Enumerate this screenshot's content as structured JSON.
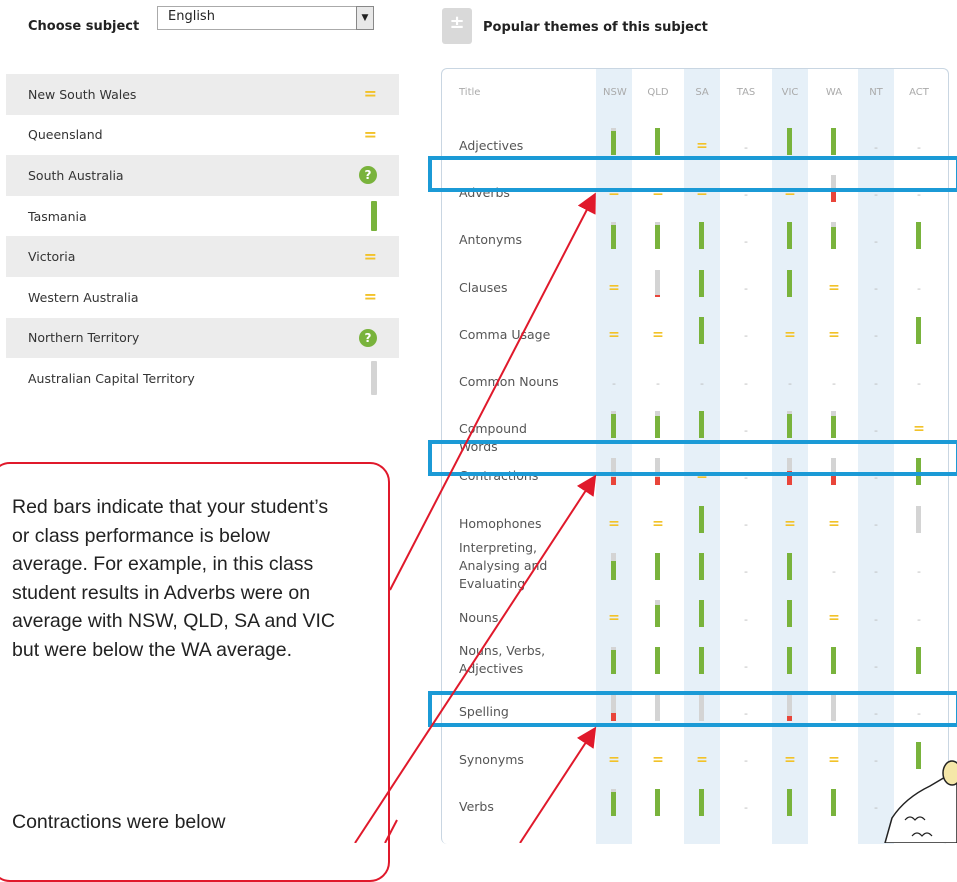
{
  "left_panel": {
    "choose_label": "Choose subject",
    "subject_value": "English",
    "states": [
      {
        "name": "New South Wales",
        "indicator": "equal",
        "shaded": true
      },
      {
        "name": "Queensland",
        "indicator": "equal",
        "shaded": false
      },
      {
        "name": "South Australia",
        "indicator": "question",
        "shaded": true
      },
      {
        "name": "Tasmania",
        "indicator": "green-bar",
        "shaded": false
      },
      {
        "name": "Victoria",
        "indicator": "equal",
        "shaded": true
      },
      {
        "name": "Western Australia",
        "indicator": "equal",
        "shaded": false
      },
      {
        "name": "Northern Territory",
        "indicator": "question",
        "shaded": true
      },
      {
        "name": "Australian Capital Territory",
        "indicator": "grey-bar",
        "shaded": false
      }
    ],
    "equal_symbol": "=",
    "question_symbol": "?"
  },
  "themes": {
    "header_title": "Popular themes of this subject",
    "icon_glyph": "±",
    "columns": [
      "Title",
      "NSW",
      "QLD",
      "SA",
      "TAS",
      "VIC",
      "WA",
      "NT",
      "ACT"
    ],
    "rows": [
      {
        "title": "Adjectives",
        "cells": [
          "g0.9",
          "g1.0",
          "eq",
          "-",
          "g1.0",
          "g1.0",
          "-",
          "-"
        ]
      },
      {
        "title": "Adverbs",
        "cells": [
          "eq",
          "eq",
          "eq",
          "-",
          "eq",
          "r0.4",
          "-",
          "-"
        ]
      },
      {
        "title": "Antonyms",
        "cells": [
          "g0.9",
          "g0.9",
          "g1.0",
          "-",
          "g1.0",
          "g0.8",
          "-",
          "g1.0"
        ]
      },
      {
        "title": "Clauses",
        "cells": [
          "eq",
          "r0.05",
          "g1.0",
          "-",
          "g1.0",
          "eq",
          "-",
          "-"
        ]
      },
      {
        "title": "Comma Usage",
        "cells": [
          "eq",
          "eq",
          "g1.0",
          "-",
          "eq",
          "eq",
          "-",
          "g1.0"
        ]
      },
      {
        "title": "Common Nouns",
        "cells": [
          "-",
          "-",
          "-",
          "-",
          "-",
          "-",
          "-",
          "-"
        ]
      },
      {
        "title": "Compound Words",
        "cells": [
          "g0.9",
          "g0.8",
          "g1.0",
          "-",
          "g0.9",
          "g0.8",
          "-",
          "eq"
        ]
      },
      {
        "title": "Contractions",
        "cells": [
          "r0.3",
          "r0.3",
          "eq",
          "-",
          "r0.5",
          "r0.4",
          "-",
          "g1.0"
        ]
      },
      {
        "title": "Homophones",
        "cells": [
          "eq",
          "eq",
          "g1.0",
          "-",
          "eq",
          "eq",
          "-",
          "grey"
        ]
      },
      {
        "title": "Interpreting, Analysing and Evaluating",
        "cells": [
          "g0.7",
          "g1.0",
          "g1.0",
          "-",
          "g1.0",
          "-",
          "-",
          "-"
        ]
      },
      {
        "title": "Nouns",
        "cells": [
          "eq",
          "g0.8",
          "g1.0",
          "-",
          "g1.0",
          "eq",
          "-",
          "-"
        ]
      },
      {
        "title": "Nouns, Verbs, Adjectives",
        "cells": [
          "g0.9",
          "g1.0",
          "g1.0",
          "-",
          "g1.0",
          "g1.0",
          "-",
          "g1.0"
        ]
      },
      {
        "title": "Spelling",
        "cells": [
          "r0.3",
          "grey",
          "grey",
          "-",
          "r0.2",
          "grey",
          "-",
          "-"
        ]
      },
      {
        "title": "Synonyms",
        "cells": [
          "eq",
          "eq",
          "eq",
          "-",
          "eq",
          "eq",
          "-",
          "g1.0"
        ]
      },
      {
        "title": "Verbs",
        "cells": [
          "g0.9",
          "g1.0",
          "g1.0",
          "-",
          "g1.0",
          "g1.0",
          "-",
          "-"
        ]
      }
    ],
    "dash_symbol": "-"
  },
  "callout": {
    "paragraph1": "Red bars indicate that your student’s or class performance is below average. For example, in this class student results in Adverbs were on average with NSW, QLD, SA and VIC but were below the WA average.",
    "paragraph2": "Contractions were below"
  },
  "colors": {
    "green": "#79b33c",
    "red": "#e9453a",
    "yellow": "#f2c229",
    "grey_bar": "#d4d4d4",
    "highlight_blue": "#1b9ad6",
    "callout_red": "#e0192b"
  }
}
